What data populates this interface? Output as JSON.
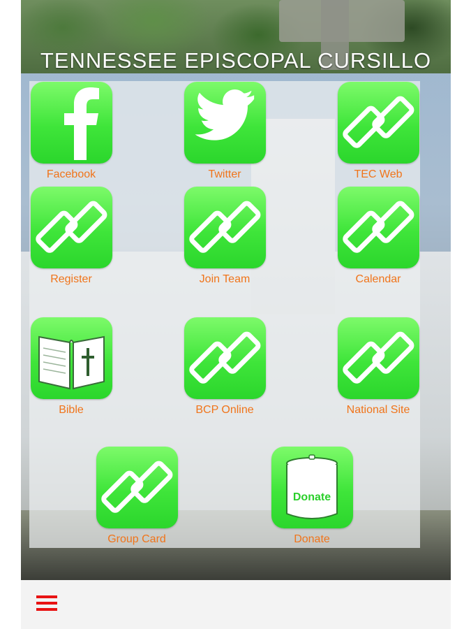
{
  "header": {
    "title": "TENNESSEE EPISCOPAL CURSILLO"
  },
  "tiles": [
    {
      "label": "Facebook",
      "icon": "facebook-icon"
    },
    {
      "label": "Twitter",
      "icon": "twitter-bird-icon"
    },
    {
      "label": "TEC Web",
      "icon": "link-chain-icon"
    },
    {
      "label": "Register",
      "icon": "link-chain-icon"
    },
    {
      "label": "Join Team",
      "icon": "link-chain-icon"
    },
    {
      "label": "Calendar",
      "icon": "link-chain-icon"
    },
    {
      "label": "Bible",
      "icon": "bible-icon"
    },
    {
      "label": "BCP Online",
      "icon": "link-chain-icon"
    },
    {
      "label": "National Site",
      "icon": "link-chain-icon"
    },
    {
      "label": "Group Card",
      "icon": "link-chain-icon"
    },
    {
      "label": "Donate",
      "icon": "donate-can-icon",
      "can_text": "Donate"
    }
  ],
  "bottom_bar": {
    "menu_icon": "hamburger-menu-icon"
  },
  "colors": {
    "tile_green": "#3fe53a",
    "label_orange": "#f0741a",
    "menu_red": "#e81313"
  }
}
